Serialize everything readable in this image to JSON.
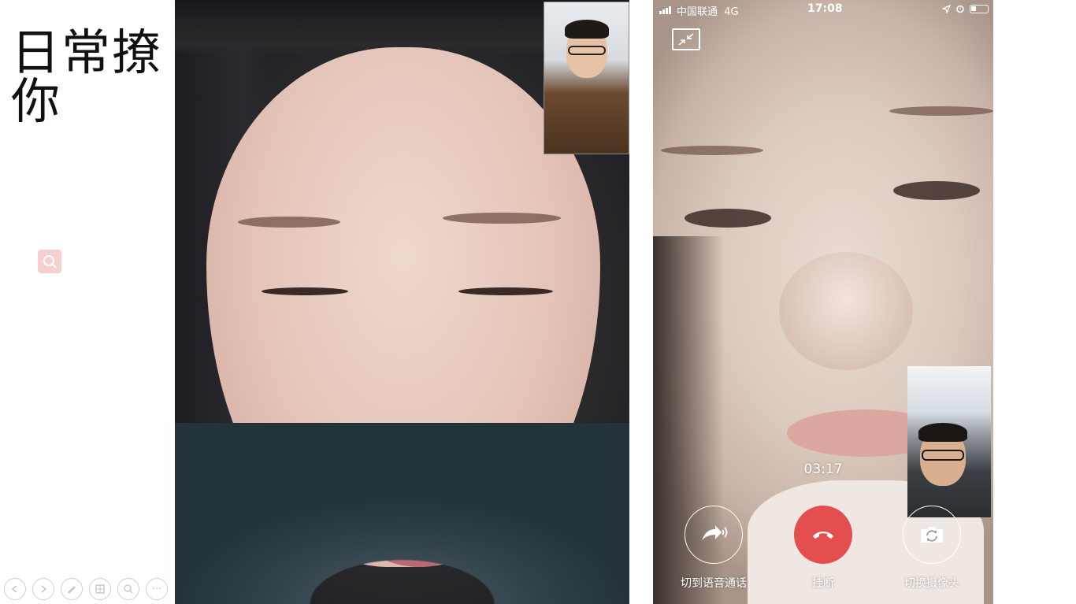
{
  "slide": {
    "title": "日常撩你",
    "search_icon": "search-icon"
  },
  "presentation_toolbar": {
    "buttons": [
      {
        "icon": "prev-arrow-icon"
      },
      {
        "icon": "next-arrow-icon"
      },
      {
        "icon": "pen-icon"
      },
      {
        "icon": "slides-grid-icon"
      },
      {
        "icon": "zoom-icon"
      },
      {
        "icon": "more-icon",
        "label": "···"
      }
    ]
  },
  "phone": {
    "status_bar": {
      "carrier": "中国联通",
      "network": "4G",
      "time": "17:08"
    },
    "call_duration": "03:17",
    "controls": {
      "switch_voice": "切到语音通话",
      "hang_up": "挂断",
      "switch_camera": "切换摄像头"
    }
  },
  "colors": {
    "hangup_red": "#e54e4e",
    "search_bg": "#f7cfcf"
  }
}
